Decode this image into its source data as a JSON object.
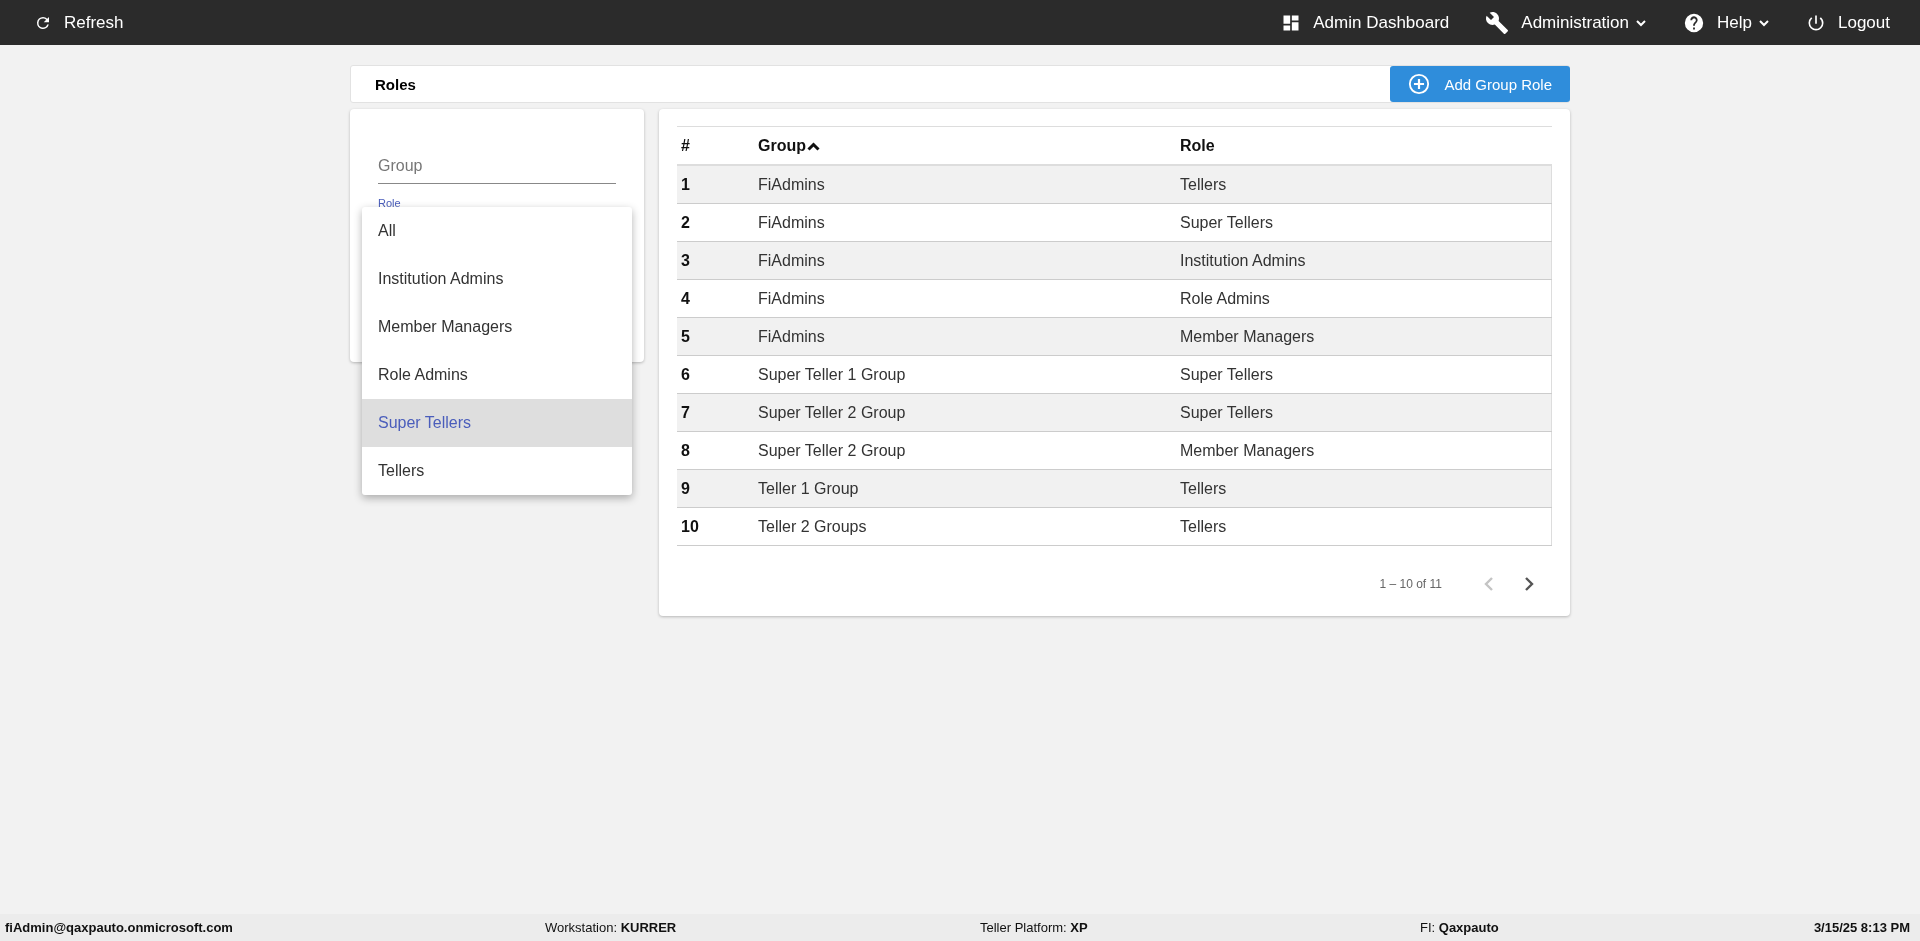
{
  "top_bar": {
    "left": [
      {
        "label": "Refresh",
        "has_menu": false
      }
    ],
    "right": [
      {
        "label": "Admin Dashboard",
        "has_menu": false
      },
      {
        "label": "Administration",
        "has_menu": true
      },
      {
        "label": "Help",
        "has_menu": true
      },
      {
        "label": "Logout",
        "has_menu": false
      }
    ]
  },
  "page_header": {
    "title": "Roles",
    "add_button": "Add Group Role"
  },
  "filters": {
    "group_field": {
      "placeholder": "Group"
    },
    "role_field": {
      "label": "Role"
    },
    "role_menu": [
      {
        "label": "All",
        "selected": false
      },
      {
        "label": "Institution Admins",
        "selected": false
      },
      {
        "label": "Member Managers",
        "selected": false
      },
      {
        "label": "Role Admins",
        "selected": false
      },
      {
        "label": "Super Tellers",
        "selected": true
      },
      {
        "label": "Tellers",
        "selected": false
      }
    ]
  },
  "table": {
    "columns": [
      {
        "label": "#",
        "sorted": false
      },
      {
        "label": "Group",
        "sorted": true
      },
      {
        "label": "Role",
        "sorted": false
      }
    ],
    "rows": [
      [
        "1",
        "FiAdmins",
        "Tellers"
      ],
      [
        "2",
        "FiAdmins",
        "Super Tellers"
      ],
      [
        "3",
        "FiAdmins",
        "Institution Admins"
      ],
      [
        "4",
        "FiAdmins",
        "Role Admins"
      ],
      [
        "5",
        "FiAdmins",
        "Member Managers"
      ],
      [
        "6",
        "Super Teller 1 Group",
        "Super Tellers"
      ],
      [
        "7",
        "Super Teller 2 Group",
        "Super Tellers"
      ],
      [
        "8",
        "Super Teller 2 Group",
        "Member Managers"
      ],
      [
        "9",
        "Teller 1 Group",
        "Tellers"
      ],
      [
        "10",
        "Teller 2 Groups",
        "Tellers"
      ]
    ]
  },
  "pagination": {
    "range": "1 – 10 of 11",
    "previous_disabled": true,
    "next_disabled": false
  },
  "status_bar": [
    {
      "value": "fiAdmin@qaxpauto.onmicrosoft.com"
    },
    {
      "label": "Workstation:",
      "value": "KURRER"
    },
    {
      "label": "Teller Platform:",
      "value": "XP"
    },
    {
      "label": "FI:",
      "value": "Qaxpauto"
    },
    {
      "value": "3/15/25 8:13 PM"
    }
  ]
}
